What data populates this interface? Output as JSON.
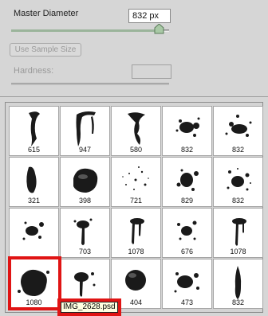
{
  "controls": {
    "master_diameter_label": "Master Diameter",
    "master_diameter_value": "832 px",
    "master_diameter_slider_level": 0.93,
    "use_sample_size_label": "Use Sample Size",
    "hardness_label": "Hardness:",
    "hardness_value": ""
  },
  "brushes": [
    {
      "size": "615",
      "shape": "stroke-a"
    },
    {
      "size": "947",
      "shape": "stroke-b"
    },
    {
      "size": "580",
      "shape": "stroke-c"
    },
    {
      "size": "832",
      "shape": "splat-a"
    },
    {
      "size": "832",
      "shape": "splat-b"
    },
    {
      "size": "321",
      "shape": "drop-a"
    },
    {
      "size": "398",
      "shape": "blob-a"
    },
    {
      "size": "721",
      "shape": "spray-a"
    },
    {
      "size": "829",
      "shape": "splat-c"
    },
    {
      "size": "832",
      "shape": "spray-b"
    },
    {
      "size": "",
      "shape": "splat-d"
    },
    {
      "size": "703",
      "shape": "drip-a"
    },
    {
      "size": "1078",
      "shape": "drip-b"
    },
    {
      "size": "676",
      "shape": "splat-e"
    },
    {
      "size": "1078",
      "shape": "drip-c"
    },
    {
      "size": "1080",
      "shape": "splat-f"
    },
    {
      "size": "",
      "shape": "drip-d"
    },
    {
      "size": "404",
      "shape": "circle"
    },
    {
      "size": "473",
      "shape": "splat-g"
    },
    {
      "size": "832",
      "shape": "drop-b"
    }
  ],
  "tooltip": "IMG_2628.psd",
  "colors": {
    "highlight": "#e01414",
    "brush_ink": "#1a1a1a"
  }
}
